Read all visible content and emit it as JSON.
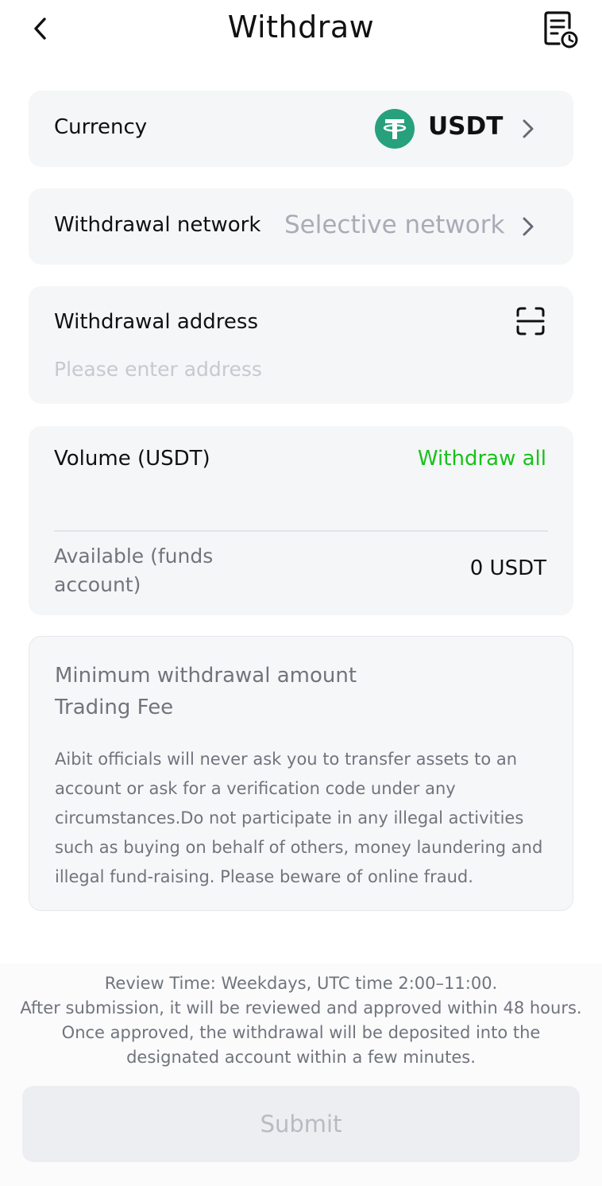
{
  "header": {
    "title": "Withdraw",
    "back_icon": "chevron-left-icon",
    "records_icon": "records-clock-icon"
  },
  "currency": {
    "label": "Currency",
    "coin": "USDT",
    "coin_icon": "tether-logo-icon",
    "coin_color": "#26a17b"
  },
  "network": {
    "label": "Withdrawal network",
    "placeholder": "Selective network"
  },
  "address": {
    "label": "Withdrawal address",
    "placeholder": "Please enter address",
    "value": "",
    "scan_icon": "scan-icon"
  },
  "volume": {
    "label": "Volume (USDT)",
    "withdraw_all": "Withdraw all",
    "value": "",
    "available_label": "Available (funds account)",
    "available_value": "0 USDT",
    "accent_color": "#17c21b"
  },
  "info": {
    "min_amount_label": "Minimum withdrawal amount",
    "trading_fee_label": "Trading Fee",
    "notice": "Aibit officials will never ask you to transfer assets to an account or ask for a verification code under any circumstances.Do not participate in any illegal activities such as buying on behalf of others, money laundering and illegal fund-raising. Please beware of online fraud."
  },
  "footer": {
    "review_line1": "Review Time: Weekdays, UTC time 2:00–11:00.",
    "review_line2": "After submission, it will be reviewed and approved within 48 hours. Once approved, the withdrawal will be deposited into the designated account within a few minutes.",
    "submit_label": "Submit"
  }
}
